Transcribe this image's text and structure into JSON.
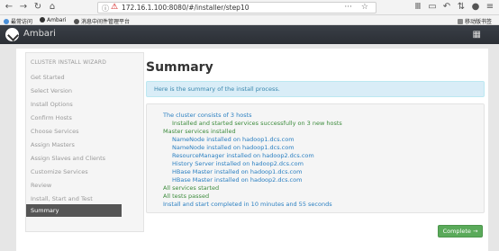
{
  "browser": {
    "url": "172.16.1.100:8080/#/installer/step10",
    "dots": "···",
    "bookmarks": [
      "最常访问",
      "Ambari",
      "消息中间件管理平台"
    ],
    "right_bookmark": "移动版书签"
  },
  "header": {
    "brand": "Ambari"
  },
  "wizard": {
    "title": "CLUSTER INSTALL WIZARD",
    "steps": [
      "Get Started",
      "Select Version",
      "Install Options",
      "Confirm Hosts",
      "Choose Services",
      "Assign Masters",
      "Assign Slaves and Clients",
      "Customize Services",
      "Review",
      "Install, Start and Test",
      "Summary"
    ],
    "active_index": 10
  },
  "main": {
    "title": "Summary",
    "info": "Here is the summary of the install process.",
    "summary_lines": [
      "The cluster consists of 3 hosts",
      "Installed and started services successfully on 3 new hosts",
      "Master services installed",
      "NameNode installed on hadoop1.dcs.com",
      "NameNode installed on hadoop1.dcs.com",
      "ResourceManager installed on hadoop2.dcs.com",
      "History Server installed on hadoop2.dcs.com",
      "HBase Master installed on hadoop1.dcs.com",
      "HBase Master installed on hadoop2.dcs.com",
      "All services started",
      "All tests passed",
      "Install and start completed in 10 minutes and 55 seconds"
    ],
    "complete_label": "Complete →"
  },
  "colors": {
    "header_bg": "#2f3338",
    "info_bg": "#d9edf7",
    "success_green": "#5aaa5a",
    "link_blue": "#2a7fc1"
  }
}
